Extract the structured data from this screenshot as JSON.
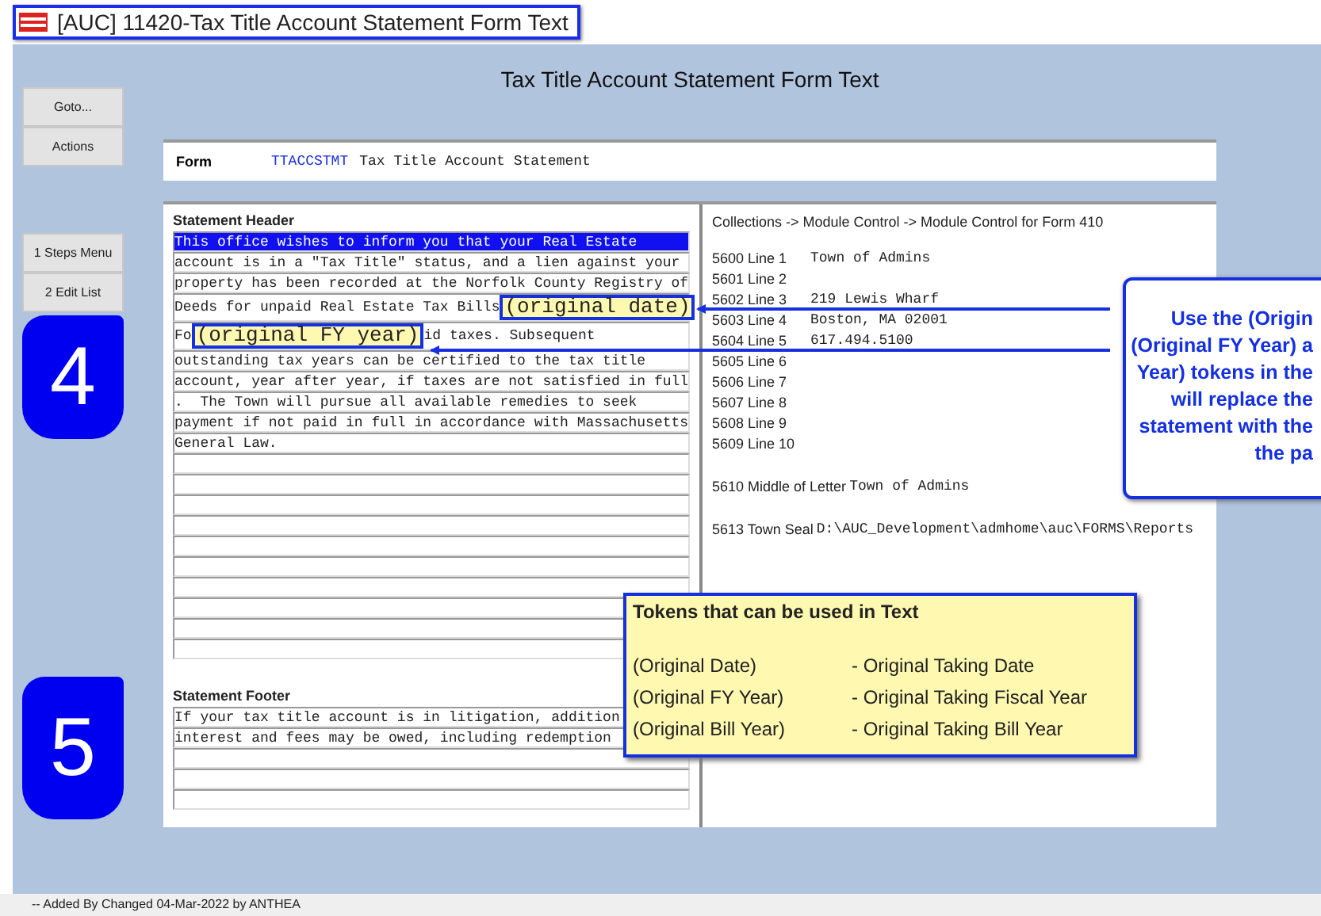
{
  "window": {
    "title": "[AUC] 11420-Tax Title Account Statement Form Text"
  },
  "heading": "Tax Title Account Statement Form Text",
  "nav_buttons": [
    "Goto...",
    "Actions"
  ],
  "step_buttons": [
    "1 Steps Menu",
    "2 Edit List"
  ],
  "step_badges": [
    "4",
    "5"
  ],
  "form": {
    "label": "Form",
    "code": "TTACCSTMT",
    "name": "Tax Title Account Statement"
  },
  "header": {
    "label": "Statement Header",
    "lines": [
      {
        "selected": true,
        "segments": [
          {
            "kind": "text",
            "text": "This office wishes to inform you that your Real Estate"
          }
        ]
      },
      {
        "selected": false,
        "segments": [
          {
            "kind": "text",
            "text": "account is in a \"Tax Title\" status, and a lien against your"
          }
        ]
      },
      {
        "selected": false,
        "segments": [
          {
            "kind": "text",
            "text": "property has been recorded at the Norfolk County Registry of"
          }
        ]
      },
      {
        "selected": false,
        "segments": [
          {
            "kind": "text",
            "text": "Deeds for unpaid Real Estate Tax Bills"
          },
          {
            "kind": "token",
            "text": "(original date)"
          }
        ]
      },
      {
        "selected": false,
        "segments": [
          {
            "kind": "text",
            "text": "Fo"
          },
          {
            "kind": "token",
            "text": "(original FY year)"
          },
          {
            "kind": "text",
            "text": "id taxes. Subsequent"
          }
        ]
      },
      {
        "selected": false,
        "segments": [
          {
            "kind": "text",
            "text": "outstanding tax years can be certified to the tax title"
          }
        ]
      },
      {
        "selected": false,
        "segments": [
          {
            "kind": "text",
            "text": "account, year after year, if taxes are not satisfied in full"
          }
        ]
      },
      {
        "selected": false,
        "segments": [
          {
            "kind": "text",
            "text": ".  The Town will pursue all available remedies to seek"
          }
        ]
      },
      {
        "selected": false,
        "segments": [
          {
            "kind": "text",
            "text": "payment if not paid in full in accordance with Massachusetts"
          }
        ]
      },
      {
        "selected": false,
        "segments": [
          {
            "kind": "text",
            "text": "General Law."
          }
        ]
      },
      {
        "selected": false
      },
      {
        "selected": false
      },
      {
        "selected": false
      },
      {
        "selected": false
      },
      {
        "selected": false
      },
      {
        "selected": false
      },
      {
        "selected": false
      },
      {
        "selected": false
      },
      {
        "selected": false
      },
      {
        "selected": false
      }
    ]
  },
  "footer": {
    "label": "Statement Footer",
    "lines": [
      {
        "selected": false,
        "segments": [
          {
            "kind": "text",
            "text": "If your tax title account is in litigation, addition"
          }
        ]
      },
      {
        "selected": false,
        "segments": [
          {
            "kind": "text",
            "text": "interest and fees may be owed, including redemption"
          }
        ]
      },
      {
        "selected": false
      },
      {
        "selected": false
      },
      {
        "selected": false
      }
    ]
  },
  "module_control": {
    "path": "Collections -> Module Control -> Module Control for Form 410",
    "groups": [
      [
        {
          "label": "5600 Line 1",
          "value": "Town of Admins"
        },
        {
          "label": "5601 Line 2"
        },
        {
          "label": "5602 Line 3",
          "value": "219 Lewis Wharf"
        },
        {
          "label": "5603 Line 4",
          "value": "Boston, MA 02001"
        },
        {
          "label": "5604 Line 5",
          "value": "617.494.5100"
        },
        {
          "label": "5605 Line 6"
        },
        {
          "label": "5606 Line 7"
        },
        {
          "label": "5607 Line 8"
        },
        {
          "label": "5608 Line 9"
        },
        {
          "label": "5609 Line 10"
        }
      ],
      [
        {
          "label": "5610 Middle of Letter",
          "value": "Town of Admins"
        }
      ],
      [
        {
          "label": "5613 Town Seal",
          "value": "D:\\AUC_Development\\admhome\\auc\\FORMS\\Reports"
        }
      ]
    ]
  },
  "callout": {
    "lines": [
      "Use the (Origin",
      "(Original FY Year) a",
      "Year) tokens in the",
      "will replace the",
      "statement with the",
      "the pa"
    ]
  },
  "tokens_box": {
    "title": "Tokens that can be used in Text",
    "rows": [
      {
        "token": "(Original Date)",
        "meaning": "- Original Taking Date"
      },
      {
        "token": "(Original FY Year)",
        "meaning": "- Original Taking Fiscal Year"
      },
      {
        "token": "(Original Bill Year)",
        "meaning": "- Original Taking Bill Year"
      }
    ]
  },
  "status_bar": "-- Added  By  Changed 04-Mar-2022 by ANTHEA"
}
